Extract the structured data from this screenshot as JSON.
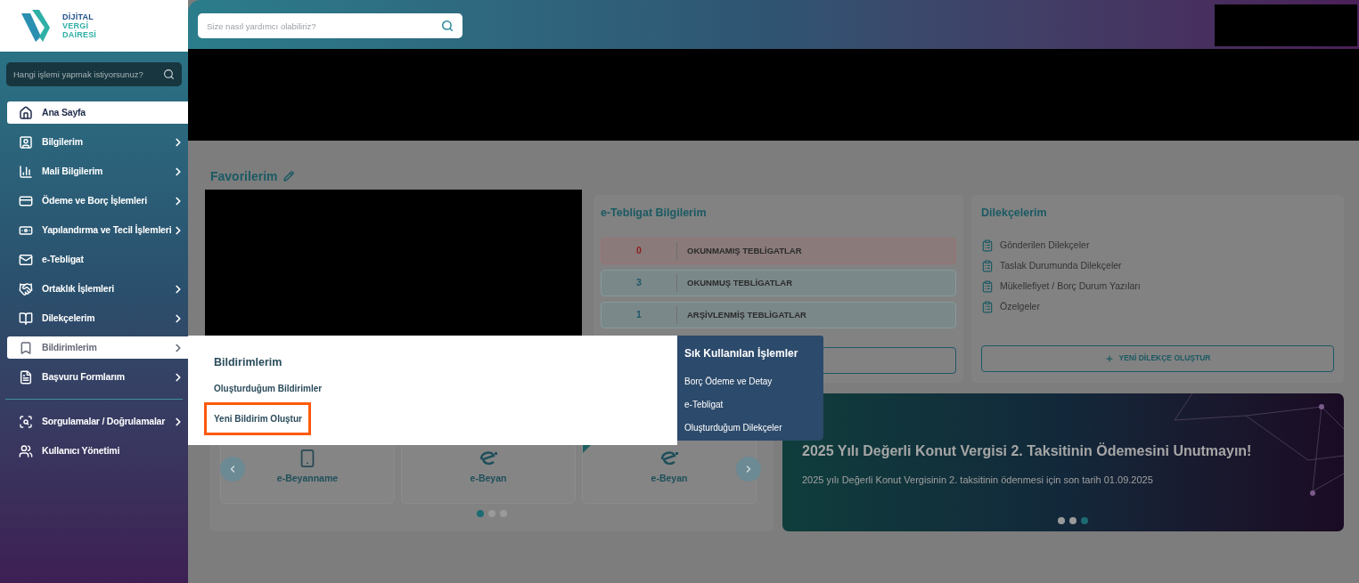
{
  "sidebar": {
    "logo": {
      "lines": [
        "DİJİTAL",
        "VERGİ",
        "DAİRESİ"
      ]
    },
    "search": {
      "placeholder": "Hangi işlemi yapmak istiyorsunuz?"
    },
    "groups": [
      {
        "items": [
          {
            "label": "Ana Sayfa",
            "selected": true,
            "expanded": false,
            "submenu": false
          },
          {
            "label": "Bilgilerim",
            "selected": false,
            "expanded": false,
            "submenu": true
          },
          {
            "label": "Mali Bilgilerim",
            "selected": false,
            "expanded": false,
            "submenu": true
          },
          {
            "label": "Ödeme ve Borç İşlemleri",
            "selected": false,
            "expanded": false,
            "submenu": true
          },
          {
            "label": "Yapılandırma ve Tecil İşlemleri",
            "selected": false,
            "expanded": false,
            "submenu": true
          },
          {
            "label": "e-Tebligat",
            "selected": false,
            "expanded": false,
            "submenu": false
          },
          {
            "label": "Ortaklık İşlemleri",
            "selected": false,
            "expanded": false,
            "submenu": true
          },
          {
            "label": "Dilekçelerim",
            "selected": false,
            "expanded": false,
            "submenu": true
          },
          {
            "label": "Bildirimlerim",
            "selected": false,
            "expanded": true,
            "submenu": true
          },
          {
            "label": "Başvuru Formlarım",
            "selected": false,
            "expanded": false,
            "submenu": true
          }
        ]
      },
      {
        "items": [
          {
            "label": "Sorgulamalar / Doğrulamalar",
            "selected": false,
            "expanded": false,
            "submenu": true
          },
          {
            "label": "Kullanıcı Yönetimi",
            "selected": false,
            "expanded": false,
            "submenu": false
          }
        ]
      }
    ]
  },
  "header": {
    "search": {
      "placeholder": "Size nasıl yardımcı olabiliriz?"
    }
  },
  "favorites": {
    "title": "Favorilerim"
  },
  "tebligat": {
    "title": "e-Tebligat Bilgilerim",
    "rows": [
      {
        "count": "0",
        "label": "OKUNMAMIŞ TEBLİGATLAR",
        "kind": "alert"
      },
      {
        "count": "3",
        "label": "OKUNMUŞ TEBLİGATLAR",
        "kind": "normal"
      },
      {
        "count": "1",
        "label": "ARŞİVLENMİŞ TEBLİGATLAR",
        "kind": "normal"
      }
    ]
  },
  "petitions": {
    "title": "Dilekçelerim",
    "items": [
      "Gönderilen Dilekçeler",
      "Taslak Durumunda Dilekçeler",
      "Mükellefiyet / Borç Durum Yazıları",
      "Özelgeler"
    ],
    "button": "YENİ DİLEKÇE OLUŞTUR"
  },
  "carousel": {
    "tiles": [
      {
        "label": "e-Beyanname",
        "kind": "document",
        "ribbon": false
      },
      {
        "label": "e-Beyan",
        "kind": "e",
        "ribbon": false
      },
      {
        "label": "e-Beyan",
        "kind": "e",
        "ribbon": true
      }
    ],
    "dots": [
      {
        "selected": true
      },
      {
        "selected": false
      },
      {
        "selected": false
      }
    ]
  },
  "banner": {
    "title": "2025 Yılı Değerli Konut Vergisi 2. Taksitinin Ödemesini Unutmayın!",
    "text": "2025 yılı Değerli Konut Vergisinin 2. taksitinin ödenmesi için son tarih 01.09.2025",
    "dots": [
      {
        "selected": false
      },
      {
        "selected": false
      },
      {
        "selected": true
      }
    ]
  },
  "menu": {
    "title": "Bildirimlerim",
    "links": [
      {
        "label": "Oluşturduğum Bildirimler",
        "highlighted": false
      },
      {
        "label": "Yeni Bildirim Oluştur",
        "highlighted": true
      }
    ],
    "quick": {
      "title": "Sık Kullanılan İşlemler",
      "links": [
        "Borç Ödeme ve Detay",
        "e-Tebligat",
        "Oluşturduğum Dilekçeler"
      ]
    }
  }
}
